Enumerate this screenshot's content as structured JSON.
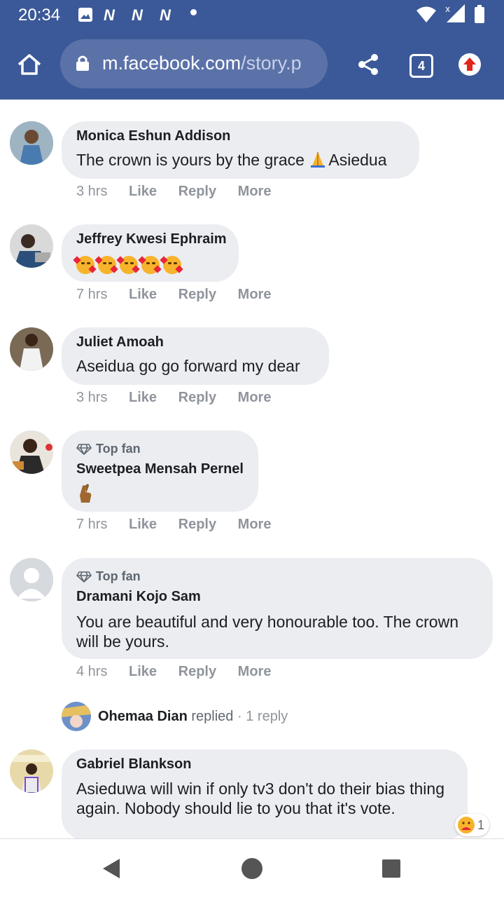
{
  "status_bar": {
    "time": "20:34",
    "n_icons": [
      "N",
      "N",
      "N"
    ]
  },
  "browser": {
    "url_domain": "m.facebook.com",
    "url_path": "/story.p",
    "tab_count": "4"
  },
  "comments": [
    {
      "name": "Monica Eshun Addison",
      "top_fan": "",
      "text_before": "The crown is yours by the grace ",
      "text_after": "Asiedua",
      "time": "3 hrs"
    },
    {
      "name": "Jeffrey Kwesi Ephraim",
      "top_fan": "",
      "emoji_count": 5,
      "time": "7 hrs"
    },
    {
      "name": "Juliet Amoah",
      "top_fan": "",
      "text": "Aseidua go go forward my dear",
      "time": "3 hrs"
    },
    {
      "name": "Sweetpea Mensah Pernel",
      "top_fan": "Top fan",
      "time": "7 hrs"
    },
    {
      "name": "Dramani Kojo Sam",
      "top_fan": "Top fan",
      "text": "You are beautiful and very honourable too. The crown will be yours.",
      "time": "4 hrs"
    },
    {
      "name": "Gabriel Blankson",
      "top_fan": "",
      "text": "Asieduwa will win if only tv3 don't do their bias thing again. Nobody should lie to you that it's vote.",
      "reaction_count": "1"
    }
  ],
  "actions": {
    "like": "Like",
    "reply": "Reply",
    "more": "More"
  },
  "reply_summary": {
    "name": "Ohemaa Dian",
    "verb": "replied",
    "sep": "·",
    "count": "1 reply"
  },
  "colors": {
    "header": "#3b5998",
    "bubble": "#ebedf0",
    "meta": "#90949c"
  }
}
